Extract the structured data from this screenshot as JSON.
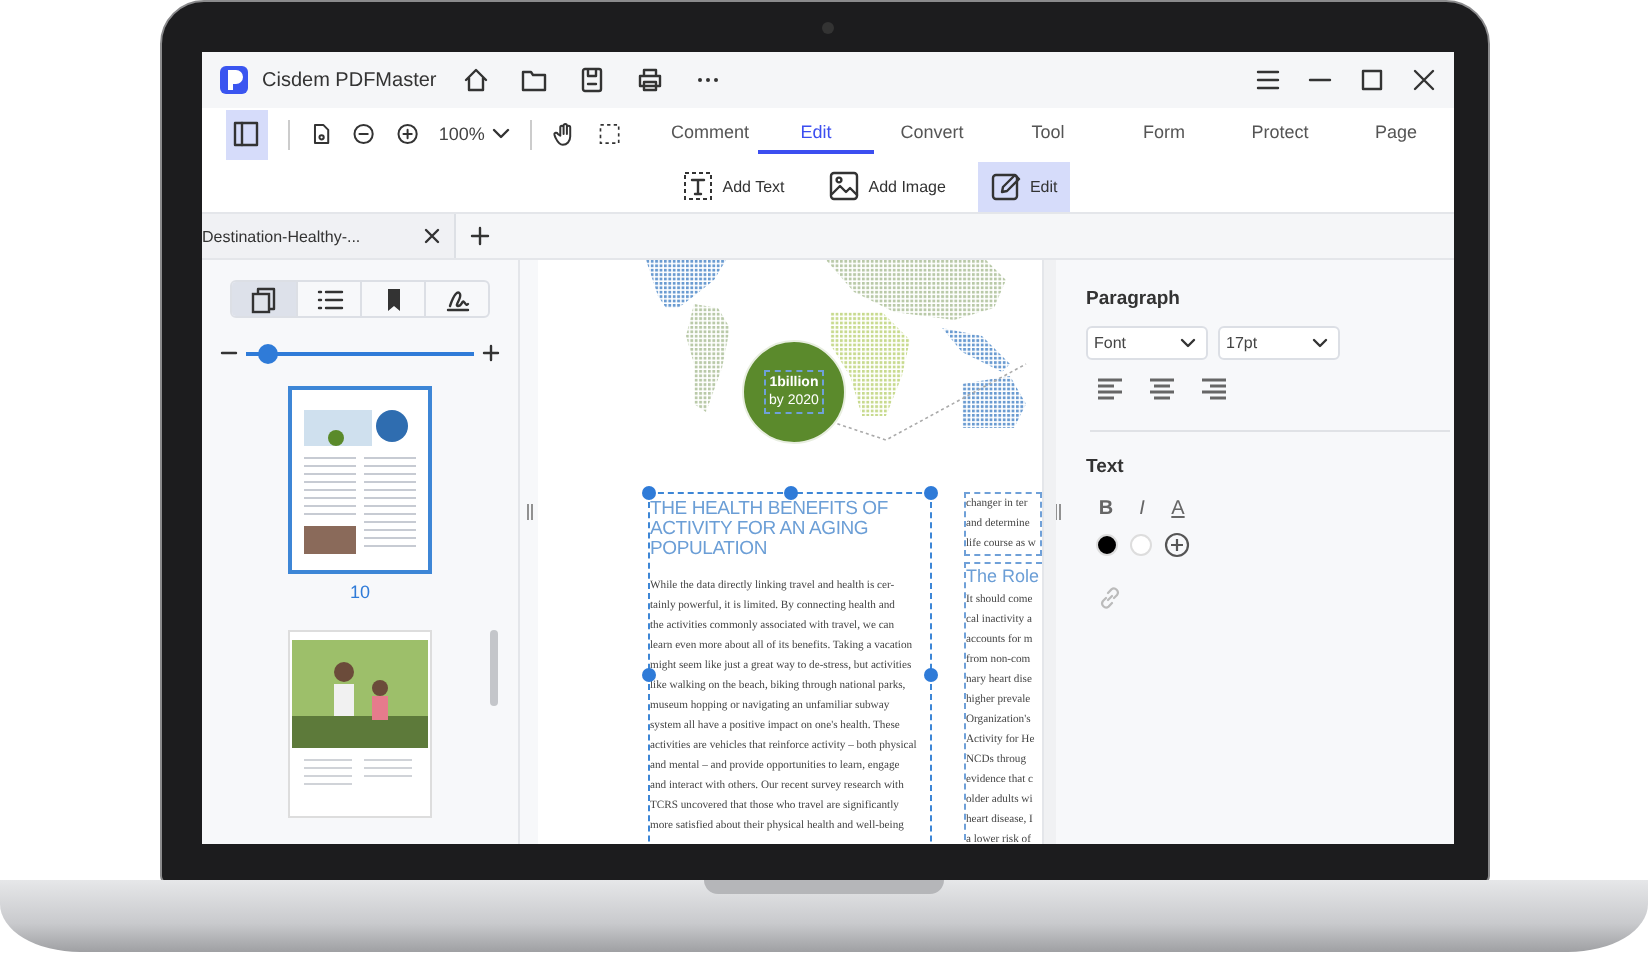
{
  "window": {
    "title": "Cisdem PDFMaster"
  },
  "toolbar": {
    "zoom": "100%",
    "sidebar_open": true
  },
  "tabs": [
    {
      "label": "Comment",
      "selected": false
    },
    {
      "label": "Edit",
      "selected": true
    },
    {
      "label": "Convert",
      "selected": false
    },
    {
      "label": "Tool",
      "selected": false
    },
    {
      "label": "Form",
      "selected": false
    },
    {
      "label": "Protect",
      "selected": false
    },
    {
      "label": "Page",
      "selected": false
    }
  ],
  "edit_tools": [
    {
      "kind": "add-text",
      "label": "Add Text",
      "selected": false
    },
    {
      "kind": "add-image",
      "label": "Add Image",
      "selected": false
    },
    {
      "kind": "edit",
      "label": "Edit",
      "selected": true
    }
  ],
  "document_tab": {
    "title": "Destination-Healthy-..."
  },
  "sidebar": {
    "views": [
      {
        "kind": "thumbnails",
        "selected": true
      },
      {
        "kind": "outline",
        "selected": false
      },
      {
        "kind": "bookmarks",
        "selected": false
      },
      {
        "kind": "signatures",
        "selected": false
      }
    ],
    "zoom": {
      "level": 0.1
    },
    "pages": [
      {
        "kind": "text-page",
        "label": "10",
        "selected": true
      },
      {
        "kind": "photo-page",
        "selected": false
      }
    ]
  },
  "document": {
    "badge": [
      "1billion",
      "by 2020"
    ],
    "heading_lines": [
      "THE HEALTH BENEFITS OF",
      "ACTIVITY FOR AN AGING",
      "POPULATION"
    ],
    "body_lines": [
      "While the data directly linking travel and health is cer-",
      "tainly powerful, it is limited.  By connecting health and",
      "the activities commonly associated with travel, we can",
      "learn even more about all of its benefits.  Taking a vacation",
      "might seem like just a great way to de-stress, but activities",
      "like walking on the beach, biking through national parks,",
      "museum hopping or navigating an unfamiliar subway",
      "system all have a positive impact on one's health.  These",
      "activities are vehicles that reinforce activity – both physical",
      "and mental – and provide opportunities to learn, engage",
      "and interact with others.  Our recent survey research with",
      "TCRS uncovered that those who travel are significantly",
      "more satisfied about their physical health and well-being"
    ],
    "side_top_lines": [
      "changer in ter",
      "and determine",
      "life course as w"
    ],
    "side_heading": "The Role",
    "side_lines": [
      "It should come",
      "cal inactivity a",
      "accounts for m",
      "from non-com",
      "nary heart dise",
      "higher prevale",
      "Organization's",
      "Activity for He",
      "NCDs throug",
      "evidence that c",
      "older adults wi",
      "heart disease, I",
      "a lower risk of"
    ]
  },
  "properties": {
    "paragraph": {
      "title": "Paragraph",
      "font": "Font",
      "size": "17pt",
      "alignments": [
        {
          "kind": "left"
        },
        {
          "kind": "center"
        },
        {
          "kind": "right"
        }
      ]
    },
    "text": {
      "title": "Text",
      "styles": [
        {
          "kind": "bold",
          "label": "B"
        },
        {
          "kind": "italic",
          "label": "I"
        },
        {
          "kind": "underline",
          "label": "A"
        }
      ],
      "colors": [
        {
          "color": "#000000"
        },
        {
          "color": "#ffffff"
        }
      ]
    }
  }
}
